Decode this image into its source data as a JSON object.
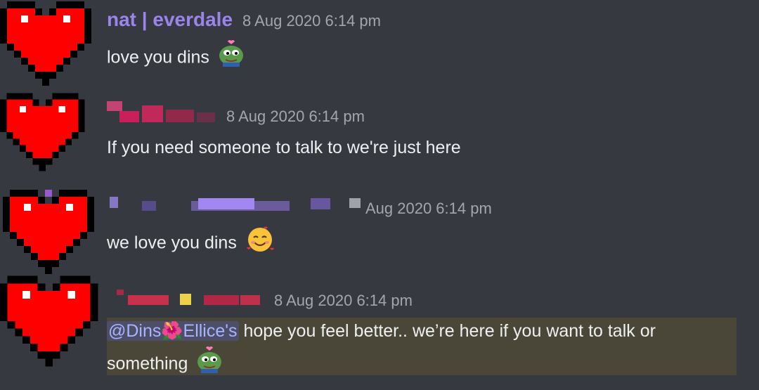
{
  "messages": [
    {
      "author": "nat | everdale",
      "author_color": "#9b84ec",
      "timestamp": "8 Aug 2020 6:14 pm",
      "text": "love you dins",
      "emoji": "pepe-heart-icon"
    },
    {
      "author": "",
      "author_color": "#e91e63",
      "timestamp": "8 Aug 2020 6:14 pm",
      "text": "If you need someone to talk to we're just here"
    },
    {
      "author": "",
      "author_color": "#8e6fe8",
      "timestamp": "Aug 2020 6:14 pm",
      "text": "we love you dins",
      "emoji": "smiling-face-with-hearts-icon"
    },
    {
      "author": "",
      "author_color": "#e91e63",
      "timestamp": "8 Aug 2020 6:14 pm",
      "mention": "@Dins🌺Ellice's",
      "text_line1": " hope you feel better.. we’re here if you want to talk or",
      "text_line2": "something",
      "emoji": "pepe-heart-icon"
    }
  ],
  "colors": {
    "background": "#36393f",
    "mention_highlight": "#4a4738",
    "heart": "#ff0000"
  }
}
